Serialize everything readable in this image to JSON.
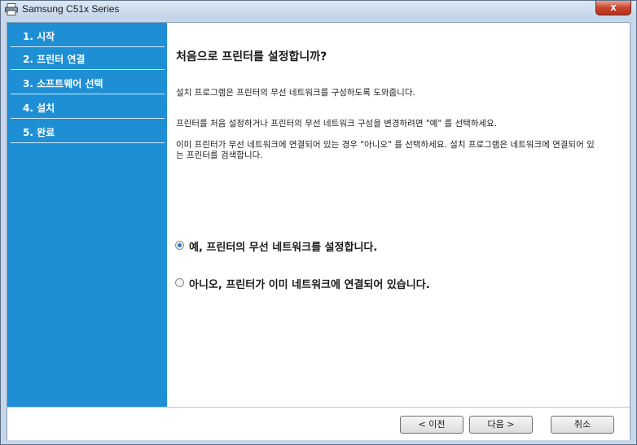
{
  "window": {
    "title": "Samsung C51x Series",
    "close_label": "x"
  },
  "sidebar": {
    "steps": [
      {
        "label": "1. 시작"
      },
      {
        "label": "2. 프린터 연결"
      },
      {
        "label": "3. 소프트웨어 선택"
      },
      {
        "label": "4. 설치"
      },
      {
        "label": "5. 완료"
      }
    ]
  },
  "content": {
    "heading": "처음으로 프린터를 설정합니까?",
    "para1": "설치 프로그램은 프린터의 무선 네트워크를 구성하도록 도와줍니다.",
    "para2": "프린터를 처음 설정하거나 프린터의 무선 네트워크 구성을 변경하려면 \"예\" 를 선택하세요.",
    "para3": "이미 프린터가 무선 네트워크에 연결되어 있는 경우 \"아니오\" 를 선택하세요. 설치 프로그램은 네트워크에 연결되어 있는 프린터를 검색합니다.",
    "options": [
      {
        "label": "예, 프린터의 무선 네트워크를 설정합니다.",
        "selected": true
      },
      {
        "label": "아니오, 프린터가 이미 네트워크에 연결되어 있습니다.",
        "selected": false
      }
    ]
  },
  "footer": {
    "back_label": "< 이전",
    "next_label": "다음 >",
    "cancel_label": "취소"
  }
}
